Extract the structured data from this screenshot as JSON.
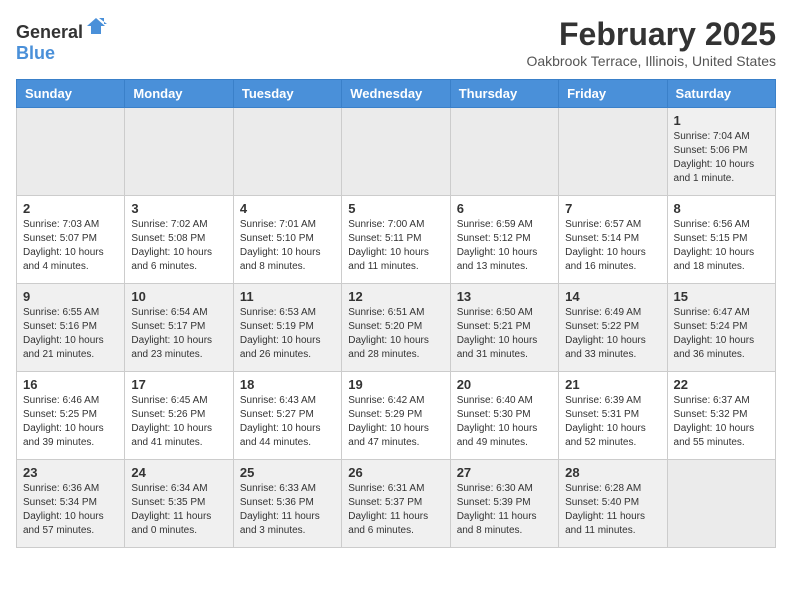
{
  "header": {
    "logo_general": "General",
    "logo_blue": "Blue",
    "month_year": "February 2025",
    "location": "Oakbrook Terrace, Illinois, United States"
  },
  "days_of_week": [
    "Sunday",
    "Monday",
    "Tuesday",
    "Wednesday",
    "Thursday",
    "Friday",
    "Saturday"
  ],
  "weeks": [
    [
      {
        "day": "",
        "info": ""
      },
      {
        "day": "",
        "info": ""
      },
      {
        "day": "",
        "info": ""
      },
      {
        "day": "",
        "info": ""
      },
      {
        "day": "",
        "info": ""
      },
      {
        "day": "",
        "info": ""
      },
      {
        "day": "1",
        "info": "Sunrise: 7:04 AM\nSunset: 5:06 PM\nDaylight: 10 hours\nand 1 minute."
      }
    ],
    [
      {
        "day": "2",
        "info": "Sunrise: 7:03 AM\nSunset: 5:07 PM\nDaylight: 10 hours\nand 4 minutes."
      },
      {
        "day": "3",
        "info": "Sunrise: 7:02 AM\nSunset: 5:08 PM\nDaylight: 10 hours\nand 6 minutes."
      },
      {
        "day": "4",
        "info": "Sunrise: 7:01 AM\nSunset: 5:10 PM\nDaylight: 10 hours\nand 8 minutes."
      },
      {
        "day": "5",
        "info": "Sunrise: 7:00 AM\nSunset: 5:11 PM\nDaylight: 10 hours\nand 11 minutes."
      },
      {
        "day": "6",
        "info": "Sunrise: 6:59 AM\nSunset: 5:12 PM\nDaylight: 10 hours\nand 13 minutes."
      },
      {
        "day": "7",
        "info": "Sunrise: 6:57 AM\nSunset: 5:14 PM\nDaylight: 10 hours\nand 16 minutes."
      },
      {
        "day": "8",
        "info": "Sunrise: 6:56 AM\nSunset: 5:15 PM\nDaylight: 10 hours\nand 18 minutes."
      }
    ],
    [
      {
        "day": "9",
        "info": "Sunrise: 6:55 AM\nSunset: 5:16 PM\nDaylight: 10 hours\nand 21 minutes."
      },
      {
        "day": "10",
        "info": "Sunrise: 6:54 AM\nSunset: 5:17 PM\nDaylight: 10 hours\nand 23 minutes."
      },
      {
        "day": "11",
        "info": "Sunrise: 6:53 AM\nSunset: 5:19 PM\nDaylight: 10 hours\nand 26 minutes."
      },
      {
        "day": "12",
        "info": "Sunrise: 6:51 AM\nSunset: 5:20 PM\nDaylight: 10 hours\nand 28 minutes."
      },
      {
        "day": "13",
        "info": "Sunrise: 6:50 AM\nSunset: 5:21 PM\nDaylight: 10 hours\nand 31 minutes."
      },
      {
        "day": "14",
        "info": "Sunrise: 6:49 AM\nSunset: 5:22 PM\nDaylight: 10 hours\nand 33 minutes."
      },
      {
        "day": "15",
        "info": "Sunrise: 6:47 AM\nSunset: 5:24 PM\nDaylight: 10 hours\nand 36 minutes."
      }
    ],
    [
      {
        "day": "16",
        "info": "Sunrise: 6:46 AM\nSunset: 5:25 PM\nDaylight: 10 hours\nand 39 minutes."
      },
      {
        "day": "17",
        "info": "Sunrise: 6:45 AM\nSunset: 5:26 PM\nDaylight: 10 hours\nand 41 minutes."
      },
      {
        "day": "18",
        "info": "Sunrise: 6:43 AM\nSunset: 5:27 PM\nDaylight: 10 hours\nand 44 minutes."
      },
      {
        "day": "19",
        "info": "Sunrise: 6:42 AM\nSunset: 5:29 PM\nDaylight: 10 hours\nand 47 minutes."
      },
      {
        "day": "20",
        "info": "Sunrise: 6:40 AM\nSunset: 5:30 PM\nDaylight: 10 hours\nand 49 minutes."
      },
      {
        "day": "21",
        "info": "Sunrise: 6:39 AM\nSunset: 5:31 PM\nDaylight: 10 hours\nand 52 minutes."
      },
      {
        "day": "22",
        "info": "Sunrise: 6:37 AM\nSunset: 5:32 PM\nDaylight: 10 hours\nand 55 minutes."
      }
    ],
    [
      {
        "day": "23",
        "info": "Sunrise: 6:36 AM\nSunset: 5:34 PM\nDaylight: 10 hours\nand 57 minutes."
      },
      {
        "day": "24",
        "info": "Sunrise: 6:34 AM\nSunset: 5:35 PM\nDaylight: 11 hours\nand 0 minutes."
      },
      {
        "day": "25",
        "info": "Sunrise: 6:33 AM\nSunset: 5:36 PM\nDaylight: 11 hours\nand 3 minutes."
      },
      {
        "day": "26",
        "info": "Sunrise: 6:31 AM\nSunset: 5:37 PM\nDaylight: 11 hours\nand 6 minutes."
      },
      {
        "day": "27",
        "info": "Sunrise: 6:30 AM\nSunset: 5:39 PM\nDaylight: 11 hours\nand 8 minutes."
      },
      {
        "day": "28",
        "info": "Sunrise: 6:28 AM\nSunset: 5:40 PM\nDaylight: 11 hours\nand 11 minutes."
      },
      {
        "day": "",
        "info": ""
      }
    ]
  ]
}
